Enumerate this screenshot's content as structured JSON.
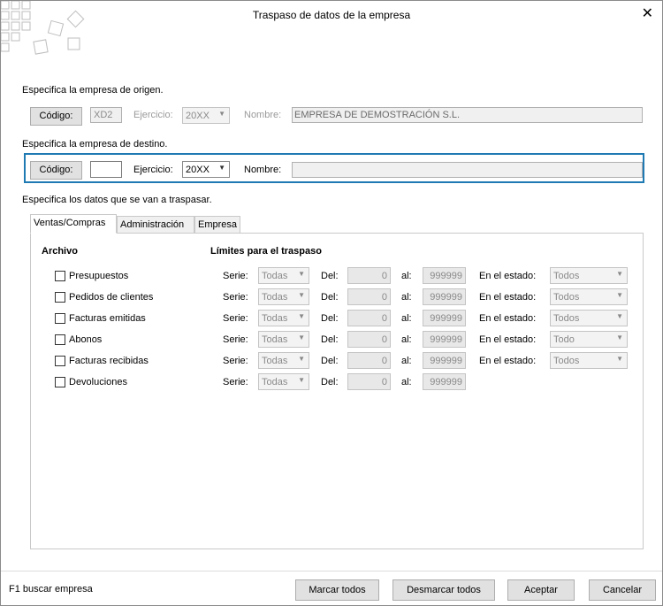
{
  "window": {
    "title": "Traspaso de datos de la empresa"
  },
  "origin": {
    "section_label": "Especifica  la empresa de origen.",
    "codigo_button": "Código:",
    "codigo_value": "XD2",
    "ejercicio_label": "Ejercicio:",
    "ejercicio_value": "20XX",
    "nombre_label": "Nombre:",
    "nombre_value": "EMPRESA DE DEMOSTRACIÓN S.L."
  },
  "destination": {
    "section_label": "Especifica la empresa de destino.",
    "codigo_button": "Código:",
    "codigo_value": "",
    "ejercicio_label": "Ejercicio:",
    "ejercicio_value": "20XX",
    "nombre_label": "Nombre:",
    "nombre_value": ""
  },
  "data_section": {
    "label": "Especifica los datos que se van a traspasar."
  },
  "tabs": [
    {
      "label": "Ventas/Compras"
    },
    {
      "label": "Administración"
    },
    {
      "label": "Empresa"
    }
  ],
  "panel": {
    "archivo_header": "Archivo",
    "limits_header": "Límites para el traspaso",
    "serie_label": "Serie:",
    "del_label": "Del:",
    "al_label": "al:",
    "estado_label": "En el estado:",
    "rows": [
      {
        "label": "Presupuestos",
        "serie": "Todas",
        "del": "0",
        "al": "999999",
        "estado": "Todos"
      },
      {
        "label": "Pedidos de clientes",
        "serie": "Todas",
        "del": "0",
        "al": "999999",
        "estado": "Todos"
      },
      {
        "label": "Facturas emitidas",
        "serie": "Todas",
        "del": "0",
        "al": "999999",
        "estado": "Todos"
      },
      {
        "label": "Abonos",
        "serie": "Todas",
        "del": "0",
        "al": "999999",
        "estado": "Todo"
      },
      {
        "label": "Facturas recibidas",
        "serie": "Todas",
        "del": "0",
        "al": "999999",
        "estado": "Todos"
      },
      {
        "label": "Devoluciones",
        "serie": "Todas",
        "del": "0",
        "al": "999999",
        "estado": ""
      }
    ]
  },
  "footer": {
    "hint": "F1 buscar empresa",
    "buttons": {
      "marcar": "Marcar todos",
      "desmarcar": "Desmarcar todos",
      "aceptar": "Aceptar",
      "cancelar": "Cancelar"
    }
  },
  "colors": {
    "accent_border": "#1f7ab3"
  },
  "icons": {
    "close": "close-icon",
    "logo": "app-logo-icon",
    "dropdown": "chevron-down-icon"
  }
}
